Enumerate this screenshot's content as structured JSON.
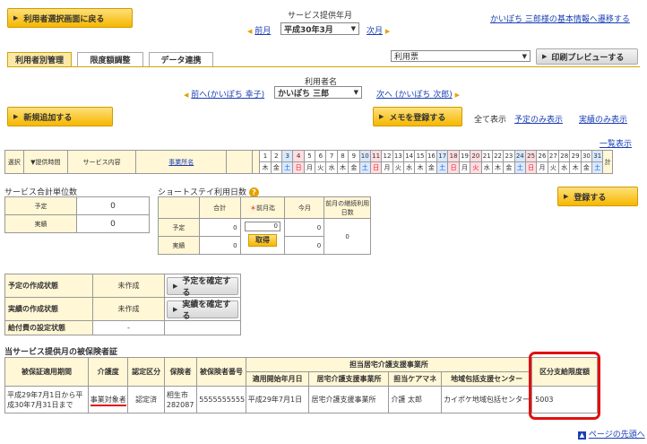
{
  "header": {
    "back_button": "利用者選択画面に戻る",
    "period_label": "サービス提供年月",
    "prev_month": "前月",
    "current_month": "平成30年3月",
    "next_month": "次月",
    "user_info_link": "かいぽち 三郎様の基本情報へ遷移する"
  },
  "tabs": [
    {
      "label": "利用者別管理"
    },
    {
      "label": "限度額調整"
    },
    {
      "label": "データ連携"
    }
  ],
  "toolbar": {
    "report_select": "利用票",
    "print_preview": "印刷プレビューする"
  },
  "user_nav": {
    "label": "利用者名",
    "prev": "前へ(かいぽち 幸子)",
    "current": "かいぽち 三郎",
    "next": "次へ (かいぽち 次郎)"
  },
  "actions": {
    "add_new": "新規追加する",
    "save_memo": "メモを登録する",
    "show_all": "全て表示",
    "show_planned": "予定のみ表示",
    "show_actual": "実績のみ表示",
    "list_view": "一覧表示"
  },
  "calendar": {
    "col_select": "選択",
    "col_time": "▼提供時間",
    "col_content": "サービス内容",
    "col_provider": "事業所名",
    "col_total": "計",
    "days": [
      "1",
      "2",
      "3",
      "4",
      "5",
      "6",
      "7",
      "8",
      "9",
      "10",
      "11",
      "12",
      "13",
      "14",
      "15",
      "16",
      "17",
      "18",
      "19",
      "20",
      "21",
      "22",
      "23",
      "24",
      "25",
      "26",
      "27",
      "28",
      "29",
      "30",
      "31"
    ],
    "weekdays": [
      "木",
      "金",
      "土",
      "日",
      "月",
      "火",
      "水",
      "木",
      "金",
      "土",
      "日",
      "月",
      "火",
      "水",
      "木",
      "金",
      "土",
      "日",
      "月",
      "火",
      "水",
      "木",
      "金",
      "土",
      "日",
      "月",
      "火",
      "水",
      "木",
      "金",
      "土"
    ]
  },
  "service_units": {
    "title": "サービス合計単位数",
    "planned_label": "予定",
    "planned_value": "0",
    "actual_label": "実績",
    "actual_value": "0"
  },
  "short_stay": {
    "title": "ショートステイ利用日数",
    "help": "?",
    "col_total": "合計",
    "col_prev_month": "前月迄",
    "col_this_month": "今月",
    "col_continuous": "前月の継続利用日数",
    "planned_label": "予定",
    "planned_total": "0",
    "prev_value": "0",
    "planned_this": "0",
    "continuous_value": "0",
    "actual_label": "実績",
    "actual_total": "0",
    "actual_this": "0",
    "fetch_button": "取得"
  },
  "register_button": "登録する",
  "status": {
    "plan_label": "予定の作成状態",
    "plan_value": "未作成",
    "confirm_plan": "予定を確定する",
    "actual_label": "実績の作成状態",
    "actual_value": "未作成",
    "confirm_actual": "実績を確定する",
    "benefit_label": "給付費の設定状態",
    "benefit_value": "-"
  },
  "insurance": {
    "title": "当サービス提供月の被保険者証",
    "h_period": "被保証適用期間",
    "h_care_level": "介護度",
    "h_cert": "認定区分",
    "h_insurer": "保険者",
    "h_insured_no": "被保険者番号",
    "h_care_office": "担当居宅介護支援事業所",
    "h_start_date": "適用開始年月日",
    "h_office_name": "居宅介護支援事業所",
    "h_care_manager": "担当ケアマネ",
    "h_center": "地域包括支援センター",
    "h_limit": "区分支給限度額",
    "period_value": "平成29年7月1日から平成30年7月31日まで",
    "care_level": "事業対象者",
    "cert": "認定済",
    "insurer": "相生市282087",
    "insured_no": "5555555555",
    "start_date": "平成29年7月1日",
    "office_name": "居宅介護支援事業所",
    "care_manager": "介護 太郎",
    "center": "カイポケ地域包括センター",
    "limit": "5003"
  },
  "page_top": "ページの先頭へ",
  "colors": {
    "accent": "#f5b700",
    "link": "#1a3fb5",
    "highlight_ring": "#e01010"
  }
}
